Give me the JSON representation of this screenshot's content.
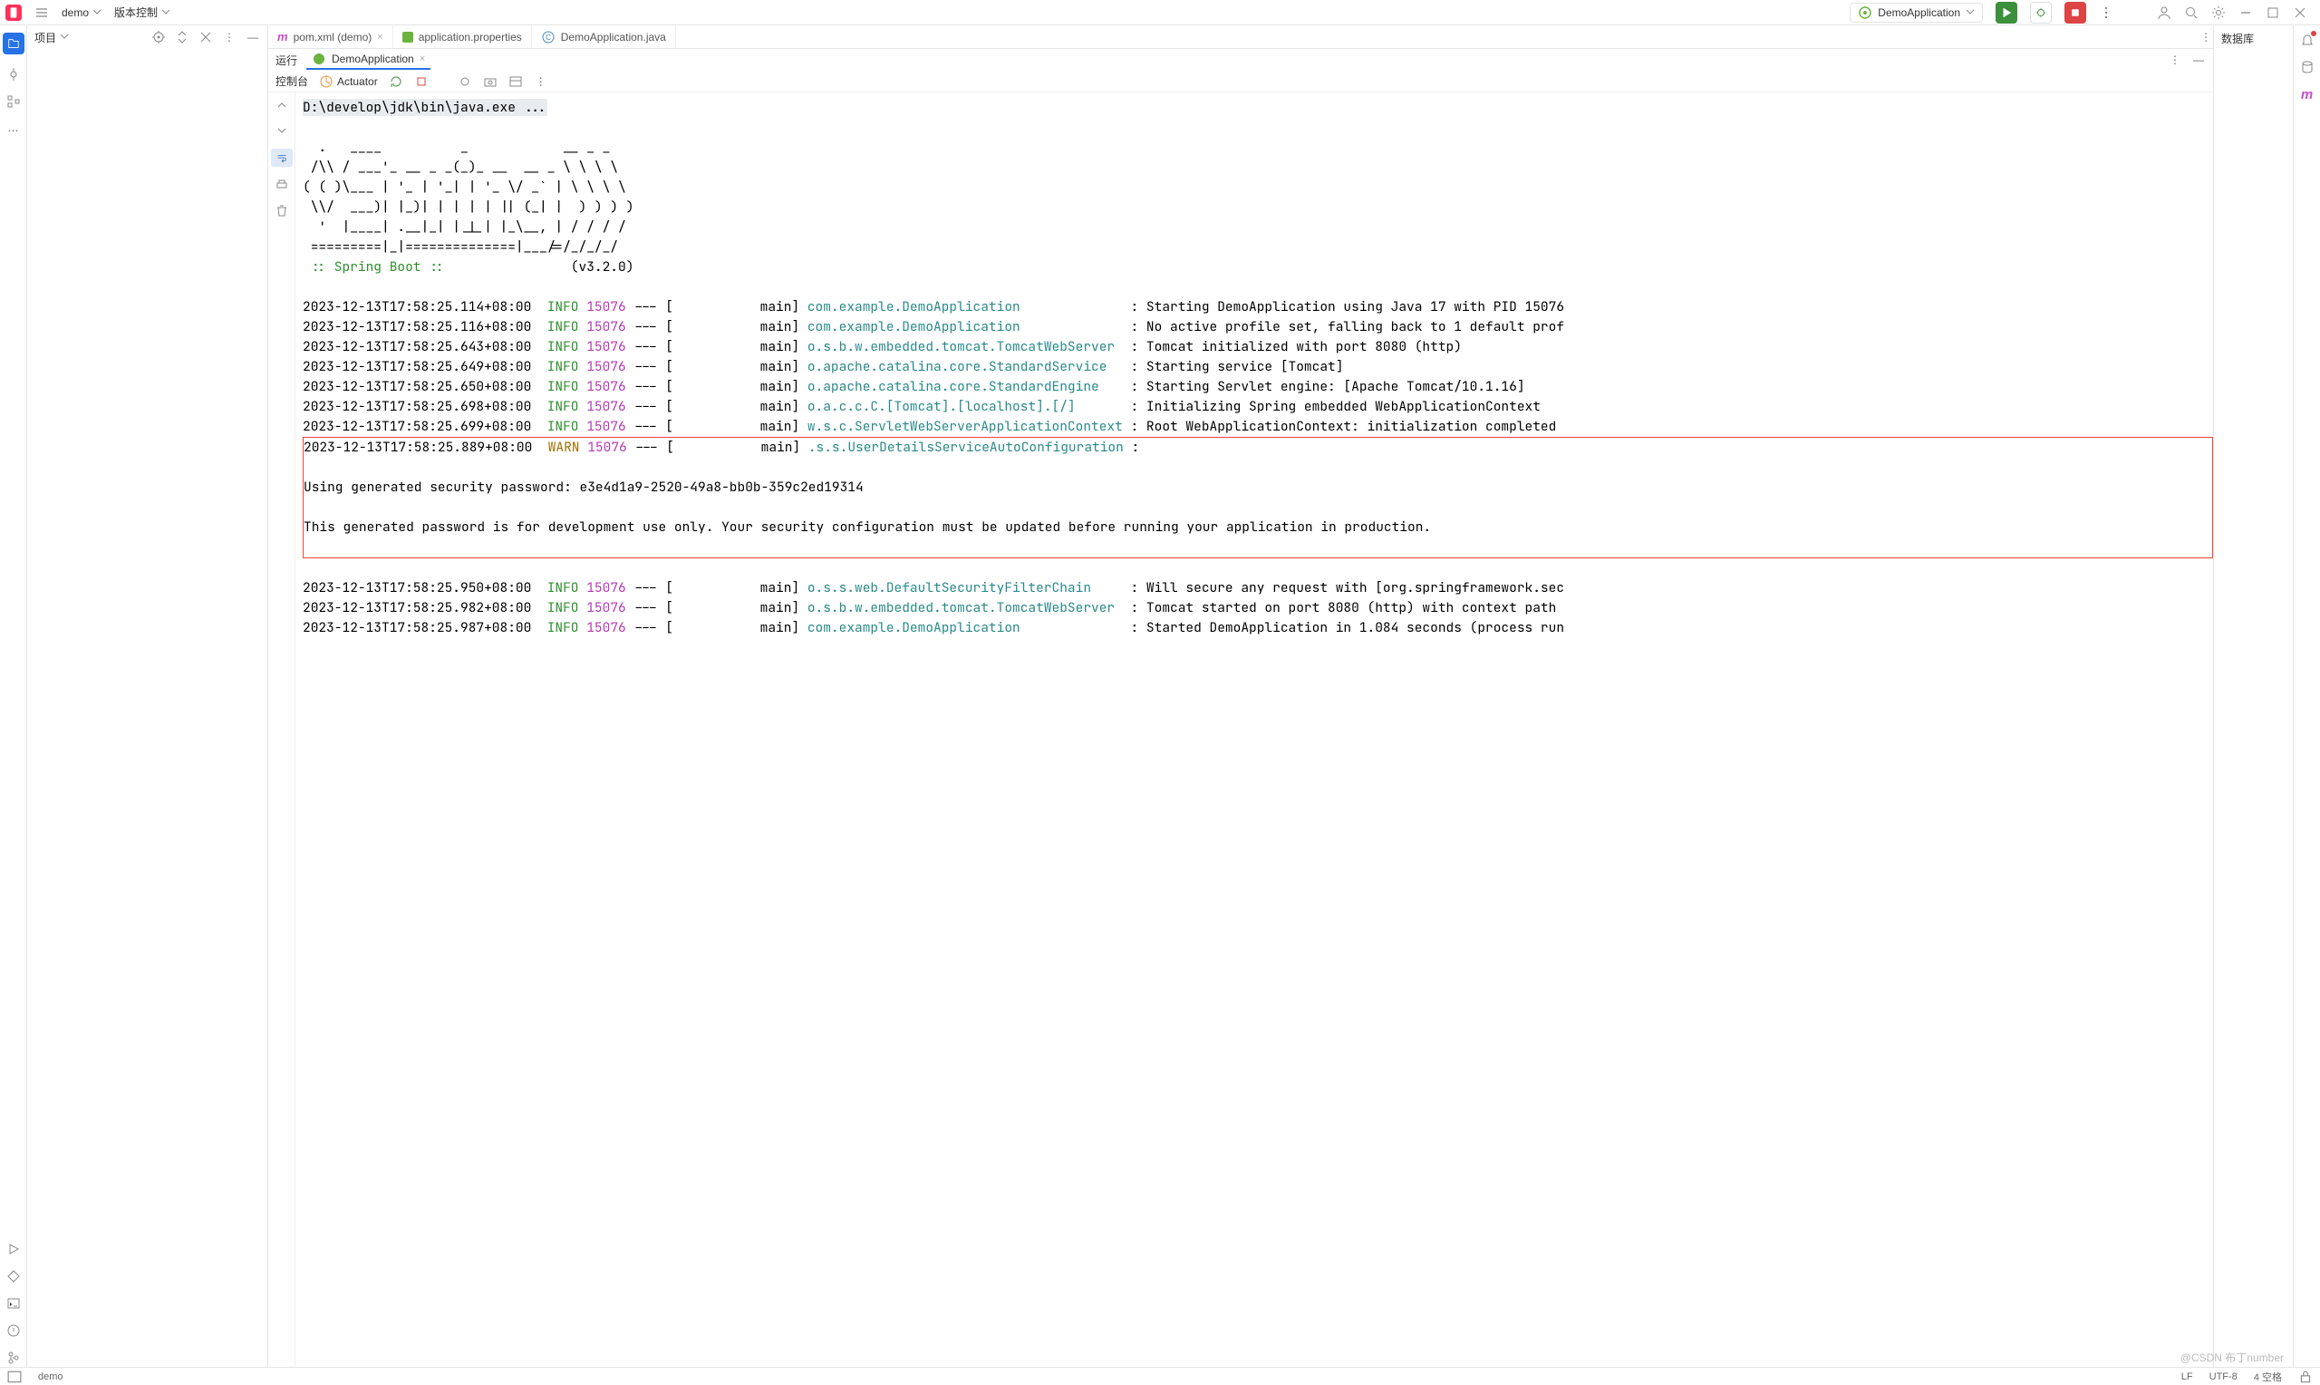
{
  "top": {
    "project": "demo",
    "vcs": "版本控制",
    "runcfg": "DemoApplication"
  },
  "project_pane": {
    "title": "项目"
  },
  "tabs": [
    {
      "label": "pom.xml (demo)"
    },
    {
      "label": "application.properties"
    },
    {
      "label": "DemoApplication.java"
    }
  ],
  "db_pane": {
    "title": "数据库"
  },
  "tool": {
    "run_label": "运行",
    "run_tab": "DemoApplication",
    "sub_console": "控制台",
    "sub_actuator": "Actuator"
  },
  "console": {
    "cmd": "D:\\develop\\jdk\\bin\\java.exe ...",
    "banner": [
      "  .   ____          _            __ _ _",
      " /\\\\ / ___'_ __ _ _(_)_ __  __ _ \\ \\ \\ \\",
      "( ( )\\___ | '_ | '_| | '_ \\/ _` | \\ \\ \\ \\",
      " \\\\/  ___)| |_)| | | | | || (_| |  ) ) ) )",
      "  '  |____| .__|_| |_|_| |_\\__, | / / / /",
      " =========|_|==============|___/=/_/_/_/"
    ],
    "boot_label": " :: Spring Boot ::",
    "boot_ver": "(v3.2.0)",
    "lines": [
      {
        "ts": "2023-12-13T17:58:25.114+08:00",
        "lvl": "INFO",
        "pid": "15076",
        "logger": "com.example.DemoApplication",
        "msg": "Starting DemoApplication using Java 17 with PID 15076"
      },
      {
        "ts": "2023-12-13T17:58:25.116+08:00",
        "lvl": "INFO",
        "pid": "15076",
        "logger": "com.example.DemoApplication",
        "msg": "No active profile set, falling back to 1 default prof"
      },
      {
        "ts": "2023-12-13T17:58:25.643+08:00",
        "lvl": "INFO",
        "pid": "15076",
        "logger": "o.s.b.w.embedded.tomcat.TomcatWebServer",
        "msg": "Tomcat initialized with port 8080 (http)"
      },
      {
        "ts": "2023-12-13T17:58:25.649+08:00",
        "lvl": "INFO",
        "pid": "15076",
        "logger": "o.apache.catalina.core.StandardService",
        "msg": "Starting service [Tomcat]"
      },
      {
        "ts": "2023-12-13T17:58:25.650+08:00",
        "lvl": "INFO",
        "pid": "15076",
        "logger": "o.apache.catalina.core.StandardEngine",
        "msg": "Starting Servlet engine: [Apache Tomcat/10.1.16]"
      },
      {
        "ts": "2023-12-13T17:58:25.698+08:00",
        "lvl": "INFO",
        "pid": "15076",
        "logger": "o.a.c.c.C.[Tomcat].[localhost].[/]",
        "msg": "Initializing Spring embedded WebApplicationContext"
      },
      {
        "ts": "2023-12-13T17:58:25.699+08:00",
        "lvl": "INFO",
        "pid": "15076",
        "logger": "w.s.c.ServletWebServerApplicationContext",
        "msg": "Root WebApplicationContext: initialization completed"
      }
    ],
    "warn": {
      "ts": "2023-12-13T17:58:25.889+08:00",
      "lvl": "WARN",
      "pid": "15076",
      "logger": ".s.s.UserDetailsServiceAutoConfiguration",
      "msg": ""
    },
    "warn_body": [
      "",
      "Using generated security password: e3e4d1a9-2520-49a8-bb0b-359c2ed19314",
      "",
      "This generated password is for development use only. Your security configuration must be updated before running your application in production.",
      ""
    ],
    "after": [
      {
        "ts": "2023-12-13T17:58:25.950+08:00",
        "lvl": "INFO",
        "pid": "15076",
        "logger": "o.s.s.web.DefaultSecurityFilterChain",
        "msg": "Will secure any request with [org.springframework.sec"
      },
      {
        "ts": "2023-12-13T17:58:25.982+08:00",
        "lvl": "INFO",
        "pid": "15076",
        "logger": "o.s.b.w.embedded.tomcat.TomcatWebServer",
        "msg": "Tomcat started on port 8080 (http) with context path "
      },
      {
        "ts": "2023-12-13T17:58:25.987+08:00",
        "lvl": "INFO",
        "pid": "15076",
        "logger": "com.example.DemoApplication",
        "msg": "Started DemoApplication in 1.084 seconds (process run"
      }
    ]
  },
  "status": {
    "project": "demo",
    "encoding": "LF",
    "charset": "UTF-8",
    "indent": "4 空格"
  },
  "watermark": "@CSDN 布丁number"
}
